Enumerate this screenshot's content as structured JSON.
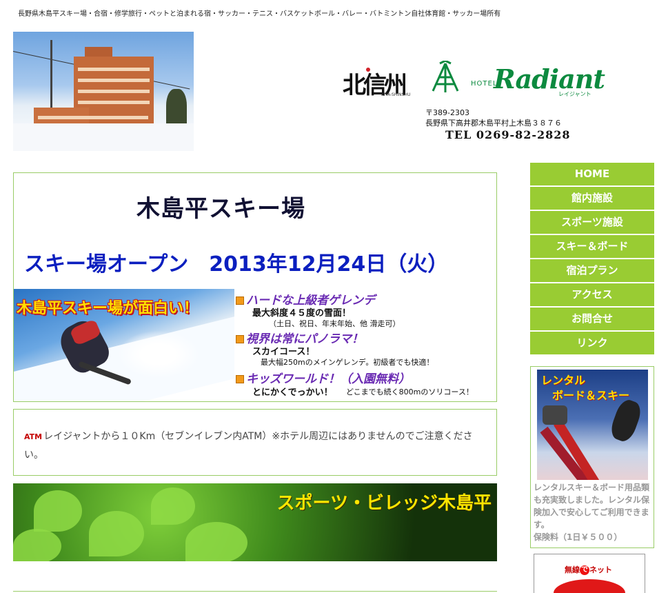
{
  "header": {
    "tagline": "長野県木島平スキー場・合宿・修学旅行・ペットと泊まれる宿・サッカー・テニス・バスケットボール・バレー・バトミントン自社体育館・サッカー場所有",
    "kita_logo_text": "北信州",
    "kita_logo_sub": "KITA-SHINSHU",
    "hotel_prefix": "HOTEL",
    "hotel_name": "Radiant",
    "hotel_kana": "レイジャント",
    "postal": "〒389-2303",
    "address": "長野県下高井郡木島平村上木島３８７６",
    "tel": "TEL 0269-82-2828"
  },
  "ski": {
    "title": "木島平スキー場",
    "open_text": "スキー場オープン　2013年12月24日（火）",
    "banner_caption": "木島平スキー場が面白い！",
    "features": [
      {
        "heading": "ハードな上級者ゲレンデ",
        "line1": "最大斜度４５度の雪面！",
        "line2": "（土日、祝日、年末年始、他 滑走可）"
      },
      {
        "heading": "視界は常にパノラマ！",
        "line1": "スカイコース！",
        "line2": "最大幅250mのメインゲレンデ。初級者でも快適！"
      },
      {
        "heading": "キッズワールド！（入園無料）",
        "line1": "とにかくでっかい！",
        "line2": "どこまでも続く800mのソリコース！"
      }
    ]
  },
  "atm": {
    "badge": "ATM",
    "text": "レイジャントから１０Km（セブンイレブン内ATM）※ホテル周辺にはありませんのでご注意ください。"
  },
  "village_banner": {
    "title": "スポーツ・ビレッジ木島平"
  },
  "nav": {
    "items": [
      "HOME",
      "館内施設",
      "スポーツ施設",
      "スキー＆ボード",
      "宿泊プラン",
      "アクセス",
      "お問合せ",
      "リンク"
    ]
  },
  "rental": {
    "caption1": "レンタル",
    "caption2": "ボード＆スキー",
    "text": "レンタルスキー＆ボード用品類も充実致しました。レンタル保険加入で安心してご利用できます。",
    "fee": "保険料（1日￥５００）"
  },
  "net": {
    "label_pre": "無線",
    "label_e": "で",
    "label_post": "ネット"
  },
  "colors": {
    "nav_bg": "#99cc33",
    "border": "#99cc66",
    "open_blue": "#0b1fbf",
    "feature_purple": "#6a2bb3",
    "hotel_green": "#0c8a3f"
  }
}
